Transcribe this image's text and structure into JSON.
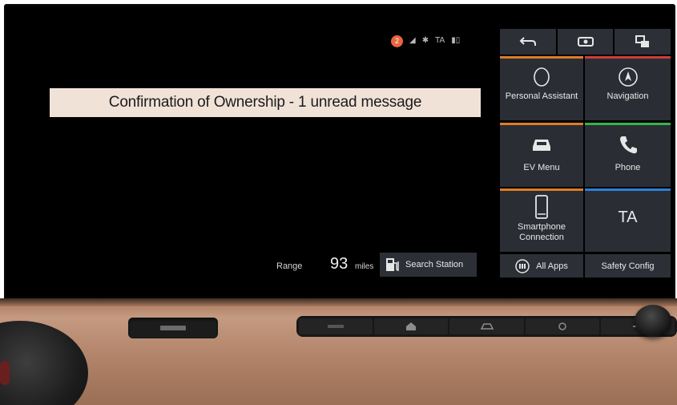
{
  "notification_count": "2",
  "banner": {
    "text": "Confirmation of Ownership - 1 unread message"
  },
  "topbar": {
    "items": [
      "back-icon",
      "media-icon",
      "screen-switch-icon"
    ]
  },
  "tiles": [
    {
      "label": "Personal Assistant",
      "icon": "assistant-icon",
      "stripe_color": "#e07b26"
    },
    {
      "label": "Navigation",
      "icon": "navigation-icon",
      "stripe_color": "#d23a3a"
    },
    {
      "label": "EV Menu",
      "icon": "ev-car-icon",
      "stripe_color": "#e07b26"
    },
    {
      "label": "Phone",
      "icon": "phone-icon",
      "stripe_color": "#38b34a"
    },
    {
      "label": "Smartphone Connection",
      "icon": "smartphone-icon",
      "stripe_color": "#e07b26"
    },
    {
      "label": "TA",
      "icon": "",
      "stripe_color": "#2f7fd6"
    }
  ],
  "bottombar": {
    "all_apps": "All Apps",
    "safety": "Safety Config"
  },
  "range": {
    "label": "Range",
    "value": "93",
    "unit": "miles"
  },
  "search_station": {
    "label": "Search Station"
  }
}
